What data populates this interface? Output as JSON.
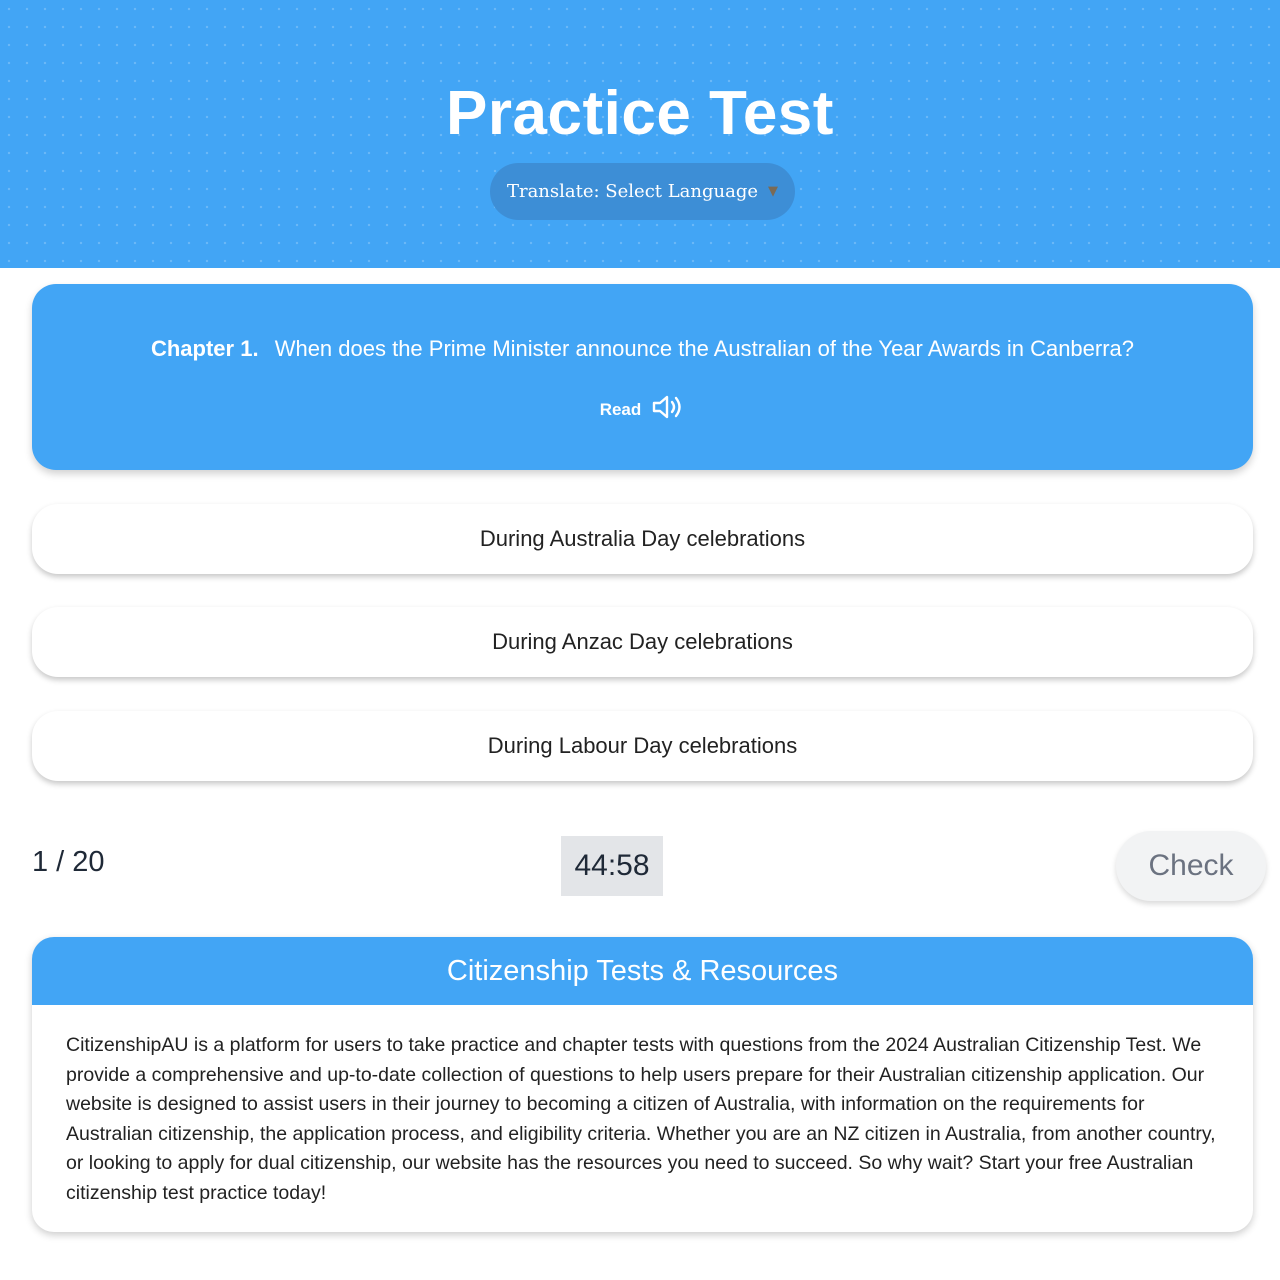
{
  "header": {
    "title": "Practice Test",
    "translate_label": "Translate: Select Language",
    "translate_caret": "▼"
  },
  "question": {
    "chapter": "Chapter 1.",
    "text": "When does the Prime Minister announce the Australian of the Year Awards in Canberra?",
    "read_label": "Read",
    "read_icon": "speaker-icon"
  },
  "answers": [
    {
      "label": "During Australia Day celebrations"
    },
    {
      "label": "During Anzac Day celebrations"
    },
    {
      "label": "During Labour Day celebrations"
    }
  ],
  "footer": {
    "progress": "1 / 20",
    "timer": "44:58",
    "check_label": "Check"
  },
  "resources": {
    "title": "Citizenship Tests & Resources",
    "body": "CitizenshipAU is a platform for users to take practice and chapter tests with questions from the 2024 Australian Citizenship Test. We provide a comprehensive and up-to-date collection of questions to help users prepare for their Australian citizenship application. Our website is designed to assist users in their journey to becoming a citizen of Australia, with information on the requirements for Australian citizenship, the application process, and eligibility criteria. Whether you are an NZ citizen in Australia, from another country, or looking to apply for dual citizenship, our website has the resources you need to succeed. So why wait? Start your free Australian citizenship test practice today!"
  },
  "colors": {
    "primary": "#42a5f5",
    "translate_bg": "#3d8ed6",
    "timer_bg": "#e3e5e8",
    "check_bg": "#f2f3f4"
  }
}
